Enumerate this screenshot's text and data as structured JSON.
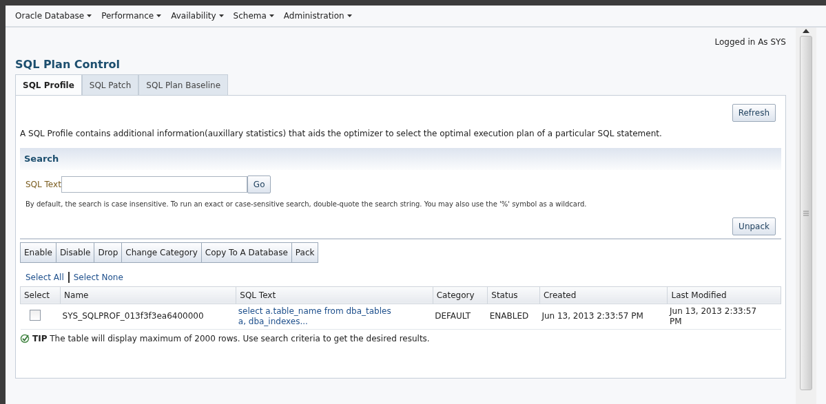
{
  "menu": [
    {
      "label": "Oracle Database"
    },
    {
      "label": "Performance"
    },
    {
      "label": "Availability"
    },
    {
      "label": "Schema"
    },
    {
      "label": "Administration"
    }
  ],
  "login": "Logged in As SYS",
  "title": "SQL Plan Control",
  "tabs": [
    {
      "label": "SQL Profile",
      "selected": true
    },
    {
      "label": "SQL Patch",
      "selected": false
    },
    {
      "label": "SQL Plan Baseline",
      "selected": false
    }
  ],
  "refresh": "Refresh",
  "description": "A SQL Profile contains additional information(auxillary statistics) that aids the optimizer to select the optimal execution plan of a particular SQL statement.",
  "search": {
    "heading": "Search",
    "label": "SQL Text",
    "go": "Go",
    "hint": "By default, the search is case insensitive. To run an exact or case-sensitive search, double-quote the search string. You may also use the '%' symbol as a wildcard."
  },
  "unpack": "Unpack",
  "actions": [
    "Enable",
    "Disable",
    "Drop",
    "Change Category",
    "Copy To A Database",
    "Pack"
  ],
  "select_links": [
    "Select All",
    "Select None"
  ],
  "table": {
    "columns": [
      "Select",
      "Name",
      "SQL Text",
      "Category",
      "Status",
      "Created",
      "Last Modified"
    ],
    "rows": [
      {
        "checked": false,
        "name": "SYS_SQLPROF_013f3f3ea6400000",
        "sql_text": "select a.table_name from dba_tables a, dba_indexes...",
        "category": "DEFAULT",
        "status": "ENABLED",
        "created": "Jun 13, 2013 2:33:57 PM",
        "last_modified": "Jun 13, 2013 2:33:57 PM"
      }
    ]
  },
  "tip": {
    "label": "TIP",
    "text": "The table will display maximum of 2000 rows. Use search criteria to get the desired results."
  }
}
